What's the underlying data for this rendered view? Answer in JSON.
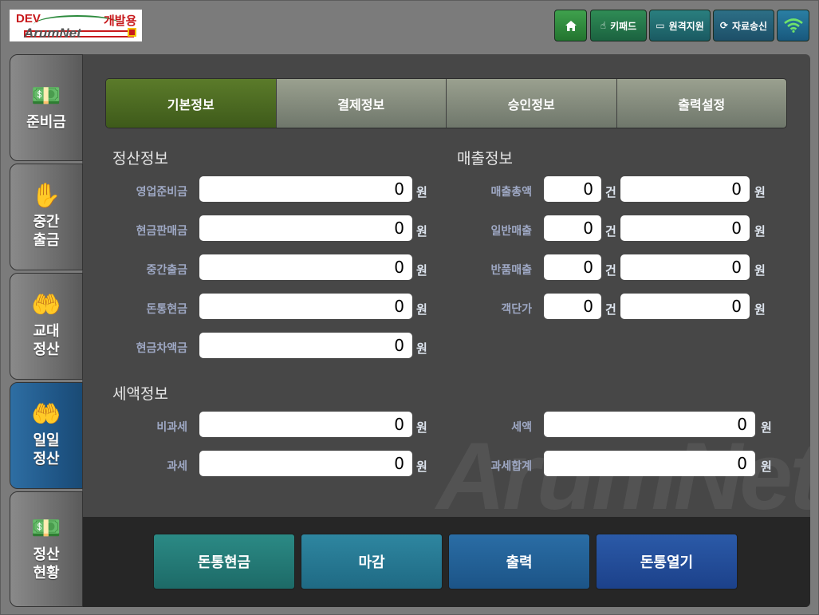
{
  "logo": {
    "env": "DEV",
    "label": "개발용",
    "brand": "ArumNet"
  },
  "topbar": {
    "home_icon": "home-icon",
    "keypad": "키패드",
    "remote": "원격지원",
    "send": "자료송신",
    "wifi_icon": "wifi-icon"
  },
  "sidebar": {
    "items": [
      {
        "label": "준비금",
        "icon": "money-stack-icon"
      },
      {
        "label": "중간\n출금",
        "icon": "hand-withdraw-icon"
      },
      {
        "label": "교대\n정산",
        "icon": "hand-coins-icon"
      },
      {
        "label": "일일\n정산",
        "icon": "hand-coins-icon",
        "active": true
      },
      {
        "label": "정산\n현황",
        "icon": "money-stack-icon"
      }
    ]
  },
  "tabs": [
    "기본정보",
    "결제정보",
    "승인정보",
    "출력설정"
  ],
  "settlement": {
    "title": "정산정보",
    "rows": [
      {
        "label": "영업준비금",
        "value": "0",
        "unit": "원"
      },
      {
        "label": "현금판매금",
        "value": "0",
        "unit": "원"
      },
      {
        "label": "중간출금",
        "value": "0",
        "unit": "원"
      },
      {
        "label": "돈통현금",
        "value": "0",
        "unit": "원"
      },
      {
        "label": "현금차액금",
        "value": "0",
        "unit": "원"
      }
    ]
  },
  "sales": {
    "title": "매출정보",
    "rows": [
      {
        "label": "매출총액",
        "count": "0",
        "count_unit": "건",
        "value": "0",
        "unit": "원"
      },
      {
        "label": "일반매출",
        "count": "0",
        "count_unit": "건",
        "value": "0",
        "unit": "원"
      },
      {
        "label": "반품매출",
        "count": "0",
        "count_unit": "건",
        "value": "0",
        "unit": "원"
      },
      {
        "label": "객단가",
        "count": "0",
        "count_unit": "건",
        "value": "0",
        "unit": "원"
      }
    ]
  },
  "tax": {
    "title": "세액정보",
    "rows": [
      {
        "label": "비과세",
        "value": "0",
        "unit": "원"
      },
      {
        "label": "과세",
        "value": "0",
        "unit": "원"
      },
      {
        "label": "세액",
        "value": "0",
        "unit": "원"
      },
      {
        "label": "과세합계",
        "value": "0",
        "unit": "원"
      }
    ]
  },
  "actions": [
    "돈통현금",
    "마감",
    "출력",
    "돈통열기"
  ],
  "watermark": "ArumNet"
}
